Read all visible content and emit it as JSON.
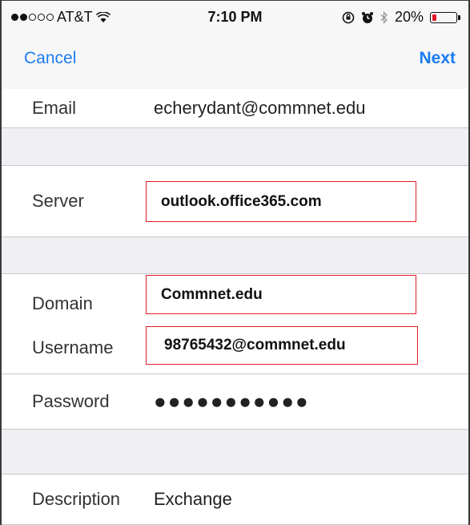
{
  "status_bar": {
    "carrier": "AT&T",
    "signal_full": 2,
    "signal_total": 5,
    "time": "7:10 PM",
    "battery": "20%",
    "battery_level": 0.2
  },
  "nav": {
    "cancel_label": "Cancel",
    "next_label": "Next"
  },
  "fields": {
    "email": {
      "label": "Email",
      "value": "echerydant@commnet.edu"
    },
    "server": {
      "label": "Server",
      "value": "outlook.office365.com"
    },
    "domain": {
      "label": "Domain",
      "value": "Commnet.edu"
    },
    "username": {
      "label": "Username",
      "value": "98765432@commnet.edu"
    },
    "password": {
      "label": "Password",
      "value": "●●●●●●●●●●●"
    },
    "description": {
      "label": "Description",
      "value": "Exchange"
    }
  },
  "colors": {
    "accent": "#1b7cf3",
    "highlight_border": "#e01f2a",
    "battery_low": "#e0182d",
    "group_background": "#efeff4"
  }
}
